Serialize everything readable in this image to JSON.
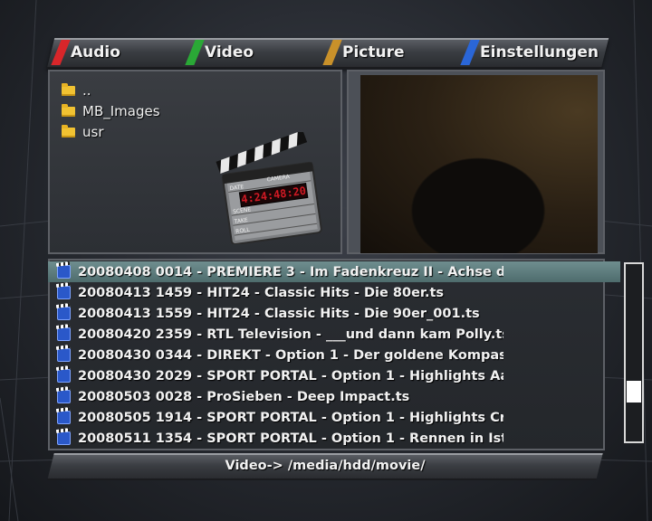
{
  "tabs": [
    {
      "label": "Audio",
      "color": "#d8262a"
    },
    {
      "label": "Video",
      "color": "#2aa836"
    },
    {
      "label": "Picture",
      "color": "#c9912a"
    },
    {
      "label": "Einstellungen",
      "color": "#2a66d8"
    }
  ],
  "browser": {
    "items": [
      {
        "label": "..",
        "icon": "folder-icon"
      },
      {
        "label": "MB_Images",
        "icon": "folder-icon"
      },
      {
        "label": "usr",
        "icon": "folder-icon"
      }
    ],
    "clapper": {
      "labels": [
        "DATE",
        "CAMERA",
        "SCENE",
        "TAKE",
        "ROLL"
      ],
      "timecode": "4:24:48:20"
    }
  },
  "list": {
    "selected_index": 0,
    "items": [
      {
        "label": "20080408 0014 - PREMIERE 3 - Im Fadenkreuz II - Achse des Bö",
        "icon": "movie-icon"
      },
      {
        "label": "20080413 1459 - HIT24 - Classic Hits - Die 80er.ts",
        "icon": "movie-icon"
      },
      {
        "label": "20080413 1559 - HIT24 - Classic Hits - Die 90er_001.ts",
        "icon": "movie-icon"
      },
      {
        "label": "20080420 2359 - RTL Television - ___und dann kam Polly.ts",
        "icon": "movie-icon"
      },
      {
        "label": "20080430 0344 - DIREKT - Option 1 - Der goldene Kompass.ts",
        "icon": "movie-icon"
      },
      {
        "label": "20080430 2029 - SPORT PORTAL - Option 1 - Highlights Aaron's",
        "icon": "movie-icon"
      },
      {
        "label": "20080503 0028 - ProSieben - Deep Impact.ts",
        "icon": "movie-icon"
      },
      {
        "label": "20080505 1914 - SPORT PORTAL - Option 1 - Highlights Crown",
        "icon": "movie-icon"
      },
      {
        "label": "20080511 1354 - SPORT PORTAL - Option 1 - Rennen in Istanbu",
        "icon": "movie-icon"
      }
    ]
  },
  "scrollbar": {
    "position": 0.75,
    "visible_fraction": 0.12
  },
  "status": {
    "path": "Video-> /media/hdd/movie/"
  }
}
